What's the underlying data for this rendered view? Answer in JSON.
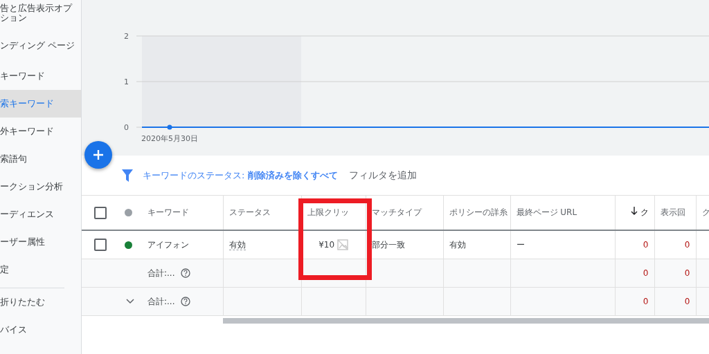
{
  "sidebar": {
    "items": [
      {
        "label": "告と広告表示オプション",
        "selected": false
      },
      {
        "label": "ンディング ページ",
        "selected": false
      },
      {
        "label": "キーワード",
        "selected": false
      },
      {
        "label": "索キーワード",
        "selected": true
      },
      {
        "label": "外キーワード",
        "selected": false
      },
      {
        "label": "索語句",
        "selected": false
      },
      {
        "label": "ークション分析",
        "selected": false
      },
      {
        "label": "ーディエンス",
        "selected": false
      },
      {
        "label": "ーザー属性",
        "selected": false
      },
      {
        "label": "定",
        "selected": false
      },
      {
        "label": "折りたたむ",
        "selected": false,
        "divider_before": true
      },
      {
        "label": "バイス",
        "selected": false
      }
    ]
  },
  "chart": {
    "chart_data": {
      "type": "line",
      "x": [
        "2020年5月30日"
      ],
      "yticks": [
        0,
        1,
        2
      ],
      "ylim": [
        0,
        2
      ],
      "series": [
        {
          "color": "#1a73e8",
          "marker": "circle",
          "values": [
            0
          ]
        }
      ]
    }
  },
  "filter": {
    "text": "キーワードのステータス: **削除済みを除くすべて**",
    "add": "フィルタを追加"
  },
  "table": {
    "columns": [
      {
        "kind": "checkbox",
        "checked": false
      },
      {
        "kind": "dot",
        "color": "#9aa0a6"
      },
      {
        "kind": "text",
        "label": "キーワード"
      },
      {
        "kind": "text",
        "label": "ステータス"
      },
      {
        "kind": "text",
        "label": "上限クリッ",
        "highlighted": true
      },
      {
        "kind": "text",
        "label": "マッチタイプ"
      },
      {
        "kind": "text",
        "label": "ポリシーの詳糸"
      },
      {
        "kind": "text",
        "label": "最終ページ URL"
      },
      {
        "kind": "sorted",
        "label": "ク"
      },
      {
        "kind": "text",
        "label": "表示回"
      },
      {
        "kind": "text",
        "label": "ク"
      }
    ],
    "rows": [
      {
        "kind": "item",
        "checked": false,
        "color": "#188038",
        "keyword": "アイフォン",
        "status": "有効",
        "cpc": "¥10",
        "match": "部分一致",
        "policy": "有効",
        "url": "ー",
        "clicks": "0",
        "impressions": "0"
      },
      {
        "kind": "total",
        "keyword": "合計:...",
        "clicks": "0",
        "impressions": "0"
      },
      {
        "kind": "total",
        "expandable": true,
        "keyword": "合計:...",
        "clicks": "0",
        "impressions": "0"
      }
    ]
  }
}
